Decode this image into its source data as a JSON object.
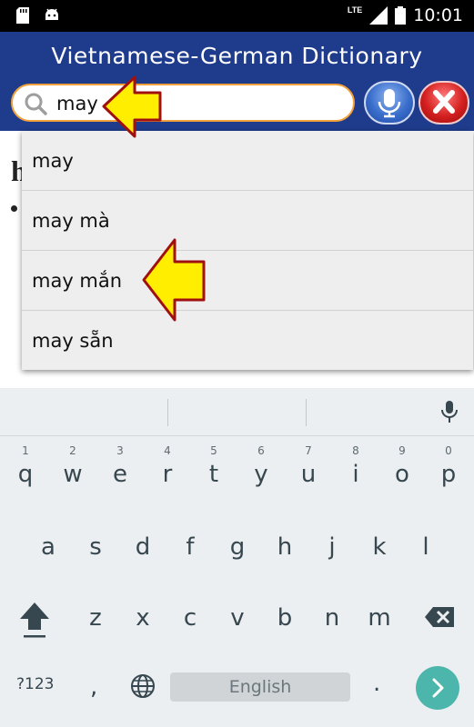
{
  "status_bar": {
    "time": "10:01",
    "network": "LTE",
    "icons": [
      "sd-card-icon",
      "android-icon",
      "signal-icon",
      "battery-icon"
    ]
  },
  "app": {
    "title": "Vietnamese-German Dictionary"
  },
  "search": {
    "query": "may",
    "icons": [
      "search-icon",
      "microphone-icon",
      "clear-icon"
    ],
    "border_color": "#f2a13a"
  },
  "content_peek": {
    "initial": "h"
  },
  "suggestions": [
    {
      "label": "may"
    },
    {
      "label": "may mà"
    },
    {
      "label": "may mắn"
    },
    {
      "label": "may sẵn"
    }
  ],
  "annotations": {
    "arrow_color": "#ffee00",
    "arrow_stroke": "#a01010"
  },
  "keyboard": {
    "row1": [
      {
        "ch": "q",
        "hint": "1"
      },
      {
        "ch": "w",
        "hint": "2"
      },
      {
        "ch": "e",
        "hint": "3"
      },
      {
        "ch": "r",
        "hint": "4"
      },
      {
        "ch": "t",
        "hint": "5"
      },
      {
        "ch": "y",
        "hint": "6"
      },
      {
        "ch": "u",
        "hint": "7"
      },
      {
        "ch": "i",
        "hint": "8"
      },
      {
        "ch": "o",
        "hint": "9"
      },
      {
        "ch": "p",
        "hint": "0"
      }
    ],
    "row2": [
      "a",
      "s",
      "d",
      "f",
      "g",
      "h",
      "j",
      "k",
      "l"
    ],
    "row3": [
      "z",
      "x",
      "c",
      "v",
      "b",
      "n",
      "m"
    ],
    "symbols_label": "?123",
    "comma": ",",
    "space_label": "English",
    "period": ".",
    "accent_color": "#4db6ac"
  }
}
